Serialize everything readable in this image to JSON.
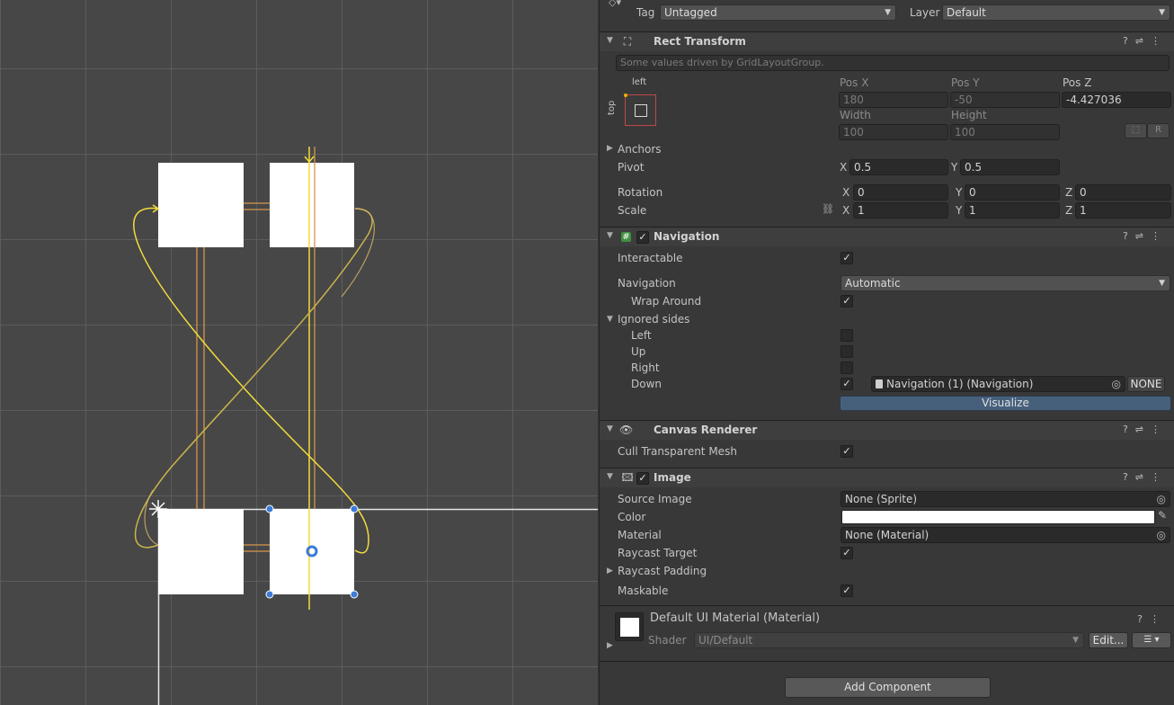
{
  "header": {
    "tag_label": "Tag",
    "tag_value": "Untagged",
    "layer_label": "Layer",
    "layer_value": "Default"
  },
  "rect_transform": {
    "title": "Rect Transform",
    "driven_note": "Some values driven by GridLayoutGroup.",
    "anchor_preset_h": "left",
    "anchor_preset_v": "top",
    "pos_x_label": "Pos X",
    "pos_x": "180",
    "pos_y_label": "Pos Y",
    "pos_y": "-50",
    "pos_z_label": "Pos Z",
    "pos_z": "-4.427036",
    "width_label": "Width",
    "width": "100",
    "height_label": "Height",
    "height": "100",
    "r_button": "R",
    "anchors_label": "Anchors",
    "pivot_label": "Pivot",
    "pivot_x": "0.5",
    "pivot_y": "0.5",
    "rotation_label": "Rotation",
    "rot_x": "0",
    "rot_y": "0",
    "rot_z": "0",
    "scale_label": "Scale",
    "scale_x": "1",
    "scale_y": "1",
    "scale_z": "1",
    "x": "X",
    "y": "Y",
    "z": "Z"
  },
  "navigation": {
    "title": "Navigation",
    "interactable_label": "Interactable",
    "interactable": true,
    "navigation_label": "Navigation",
    "navigation_value": "Automatic",
    "wrap_around_label": "Wrap Around",
    "wrap_around": true,
    "ignored_sides_label": "Ignored sides",
    "left_label": "Left",
    "left": false,
    "up_label": "Up",
    "up": false,
    "right_label": "Right",
    "right": false,
    "down_label": "Down",
    "down": true,
    "down_target": "Navigation (1) (Navigation)",
    "none_button": "NONE",
    "visualize_button": "Visualize"
  },
  "canvas_renderer": {
    "title": "Canvas Renderer",
    "cull_label": "Cull Transparent Mesh",
    "cull": true
  },
  "image": {
    "title": "Image",
    "source_image_label": "Source Image",
    "source_image": "None (Sprite)",
    "color_label": "Color",
    "color": "#ffffff",
    "material_label": "Material",
    "material": "None (Material)",
    "raycast_target_label": "Raycast Target",
    "raycast_target": true,
    "raycast_padding_label": "Raycast Padding",
    "maskable_label": "Maskable",
    "maskable": true
  },
  "material_block": {
    "title": "Default UI Material (Material)",
    "shader_label": "Shader",
    "shader_value": "UI/Default",
    "edit_button": "Edit..."
  },
  "add_component_button": "Add Component",
  "colors": {
    "scene_bg": "#474747",
    "inspector_bg": "#383838",
    "nav_arrow_yellow": "#f2dc3c",
    "nav_arrow_orange": "#d7964b",
    "visualize_active": "#46607c",
    "selection_handle": "#3c7bd8"
  }
}
